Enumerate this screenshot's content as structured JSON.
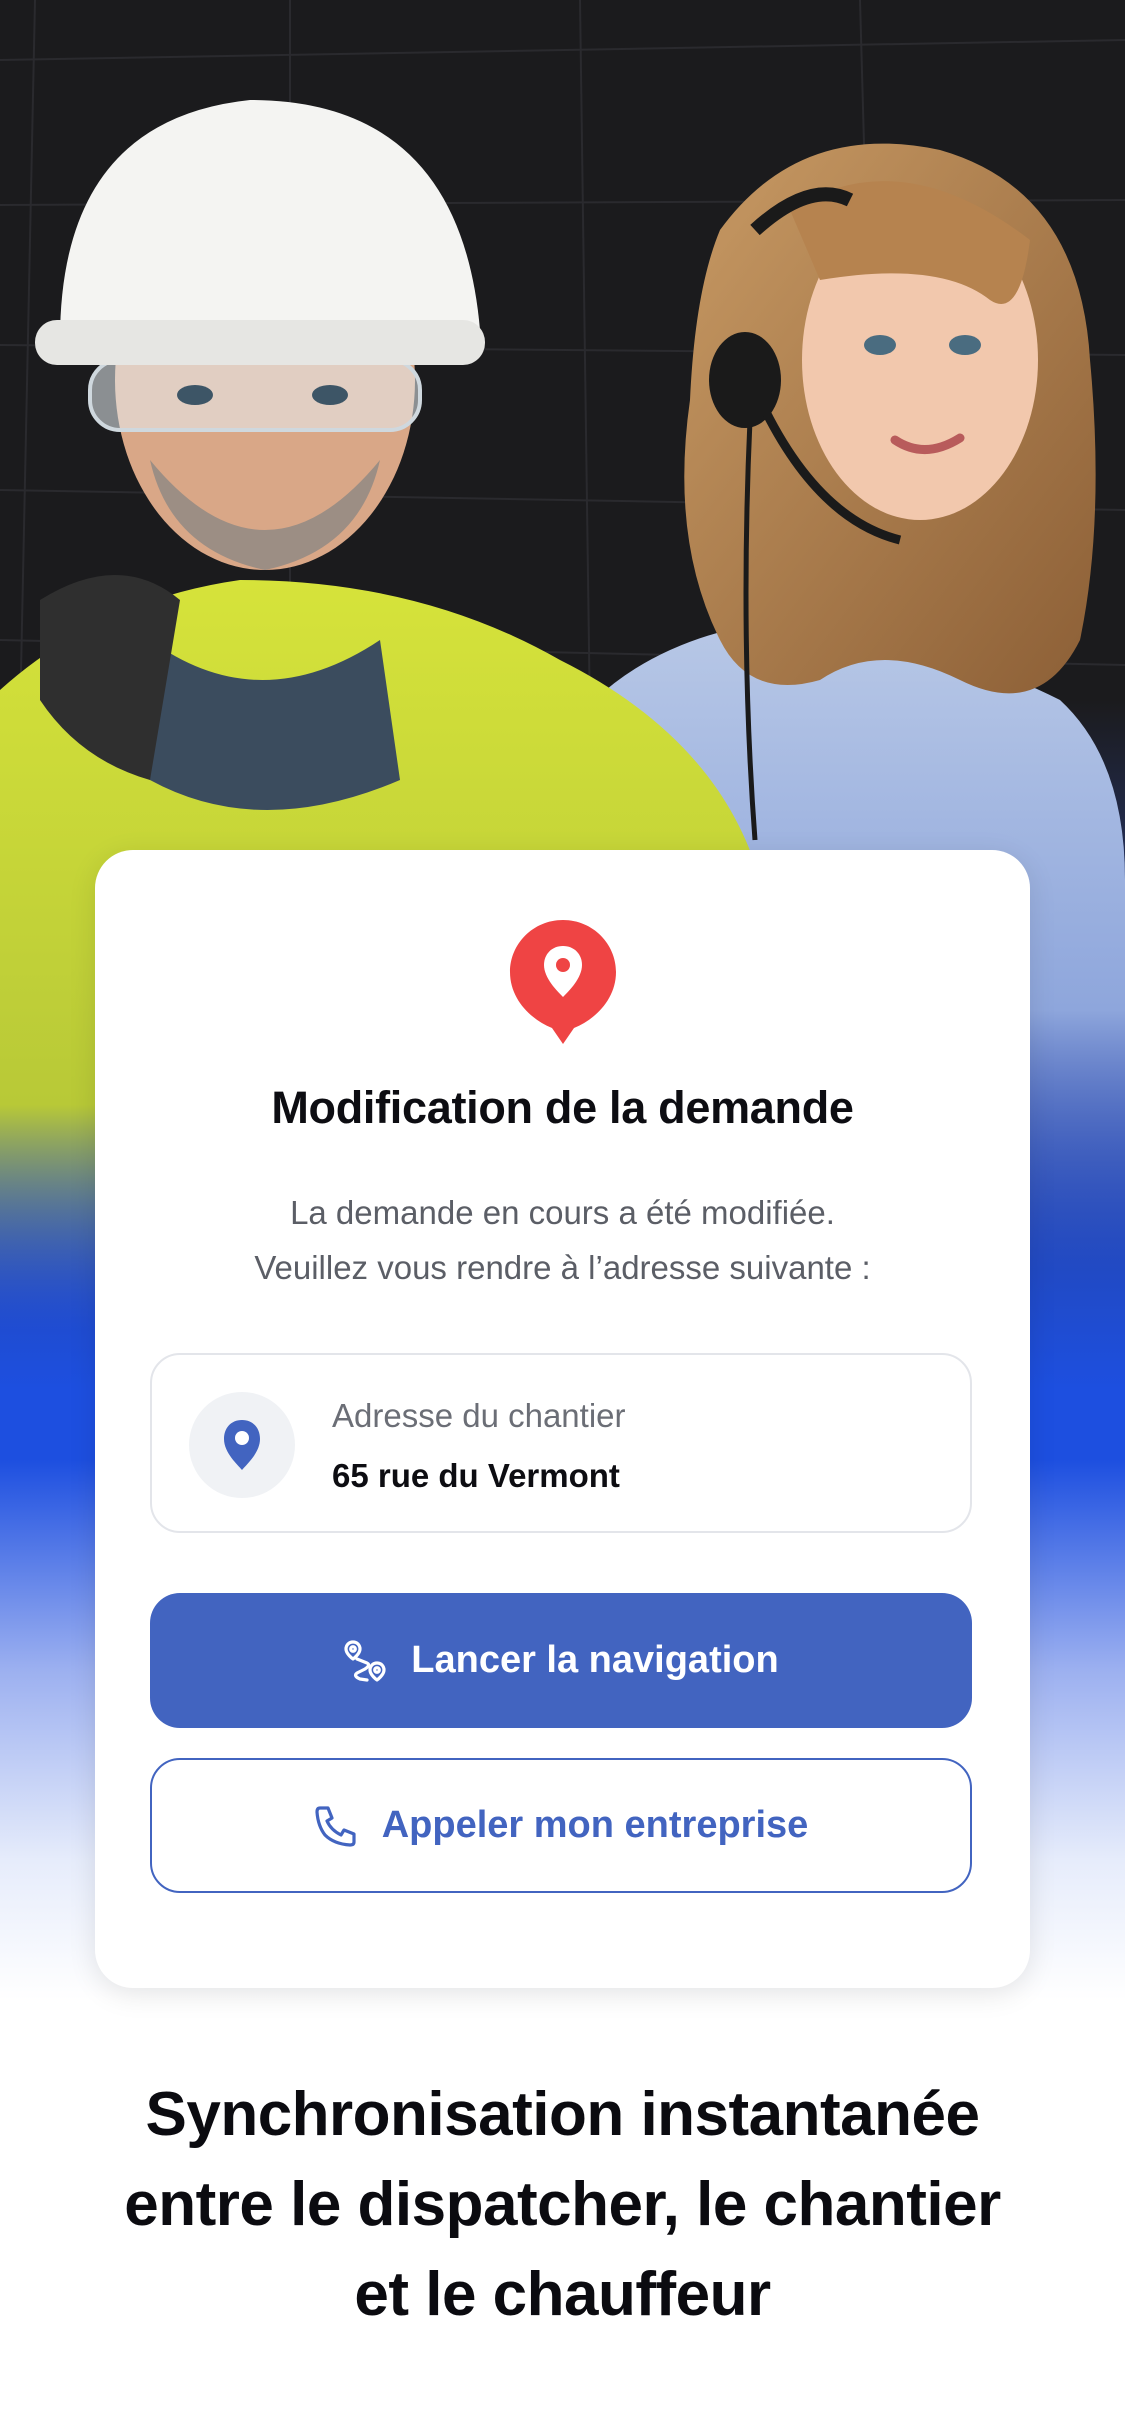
{
  "card": {
    "title": "Modification de la demande",
    "message_line1": "La demande en cours a été modifiée.",
    "message_line2": "Veuillez vous rendre à l’adresse suivante :",
    "address_label": "Adresse du chantier",
    "address_value": "65 rue du Vermont",
    "primary_button_label": "Lancer la navigation",
    "secondary_button_label": "Appeler mon entreprise"
  },
  "tagline": {
    "line1": "Synchronisation instantanée",
    "line2": "entre le dispatcher, le chantier",
    "line3": "et le chauffeur"
  },
  "colors": {
    "accent": "#4264c0",
    "pin_red": "#ef4444",
    "gradient_blue": "#1d4fe0",
    "dark_background": "#1b1b1d"
  },
  "icons": {
    "header_pin": "location-pin-icon",
    "address_pin": "map-pin-icon",
    "navigation": "route-icon",
    "call": "phone-icon"
  }
}
